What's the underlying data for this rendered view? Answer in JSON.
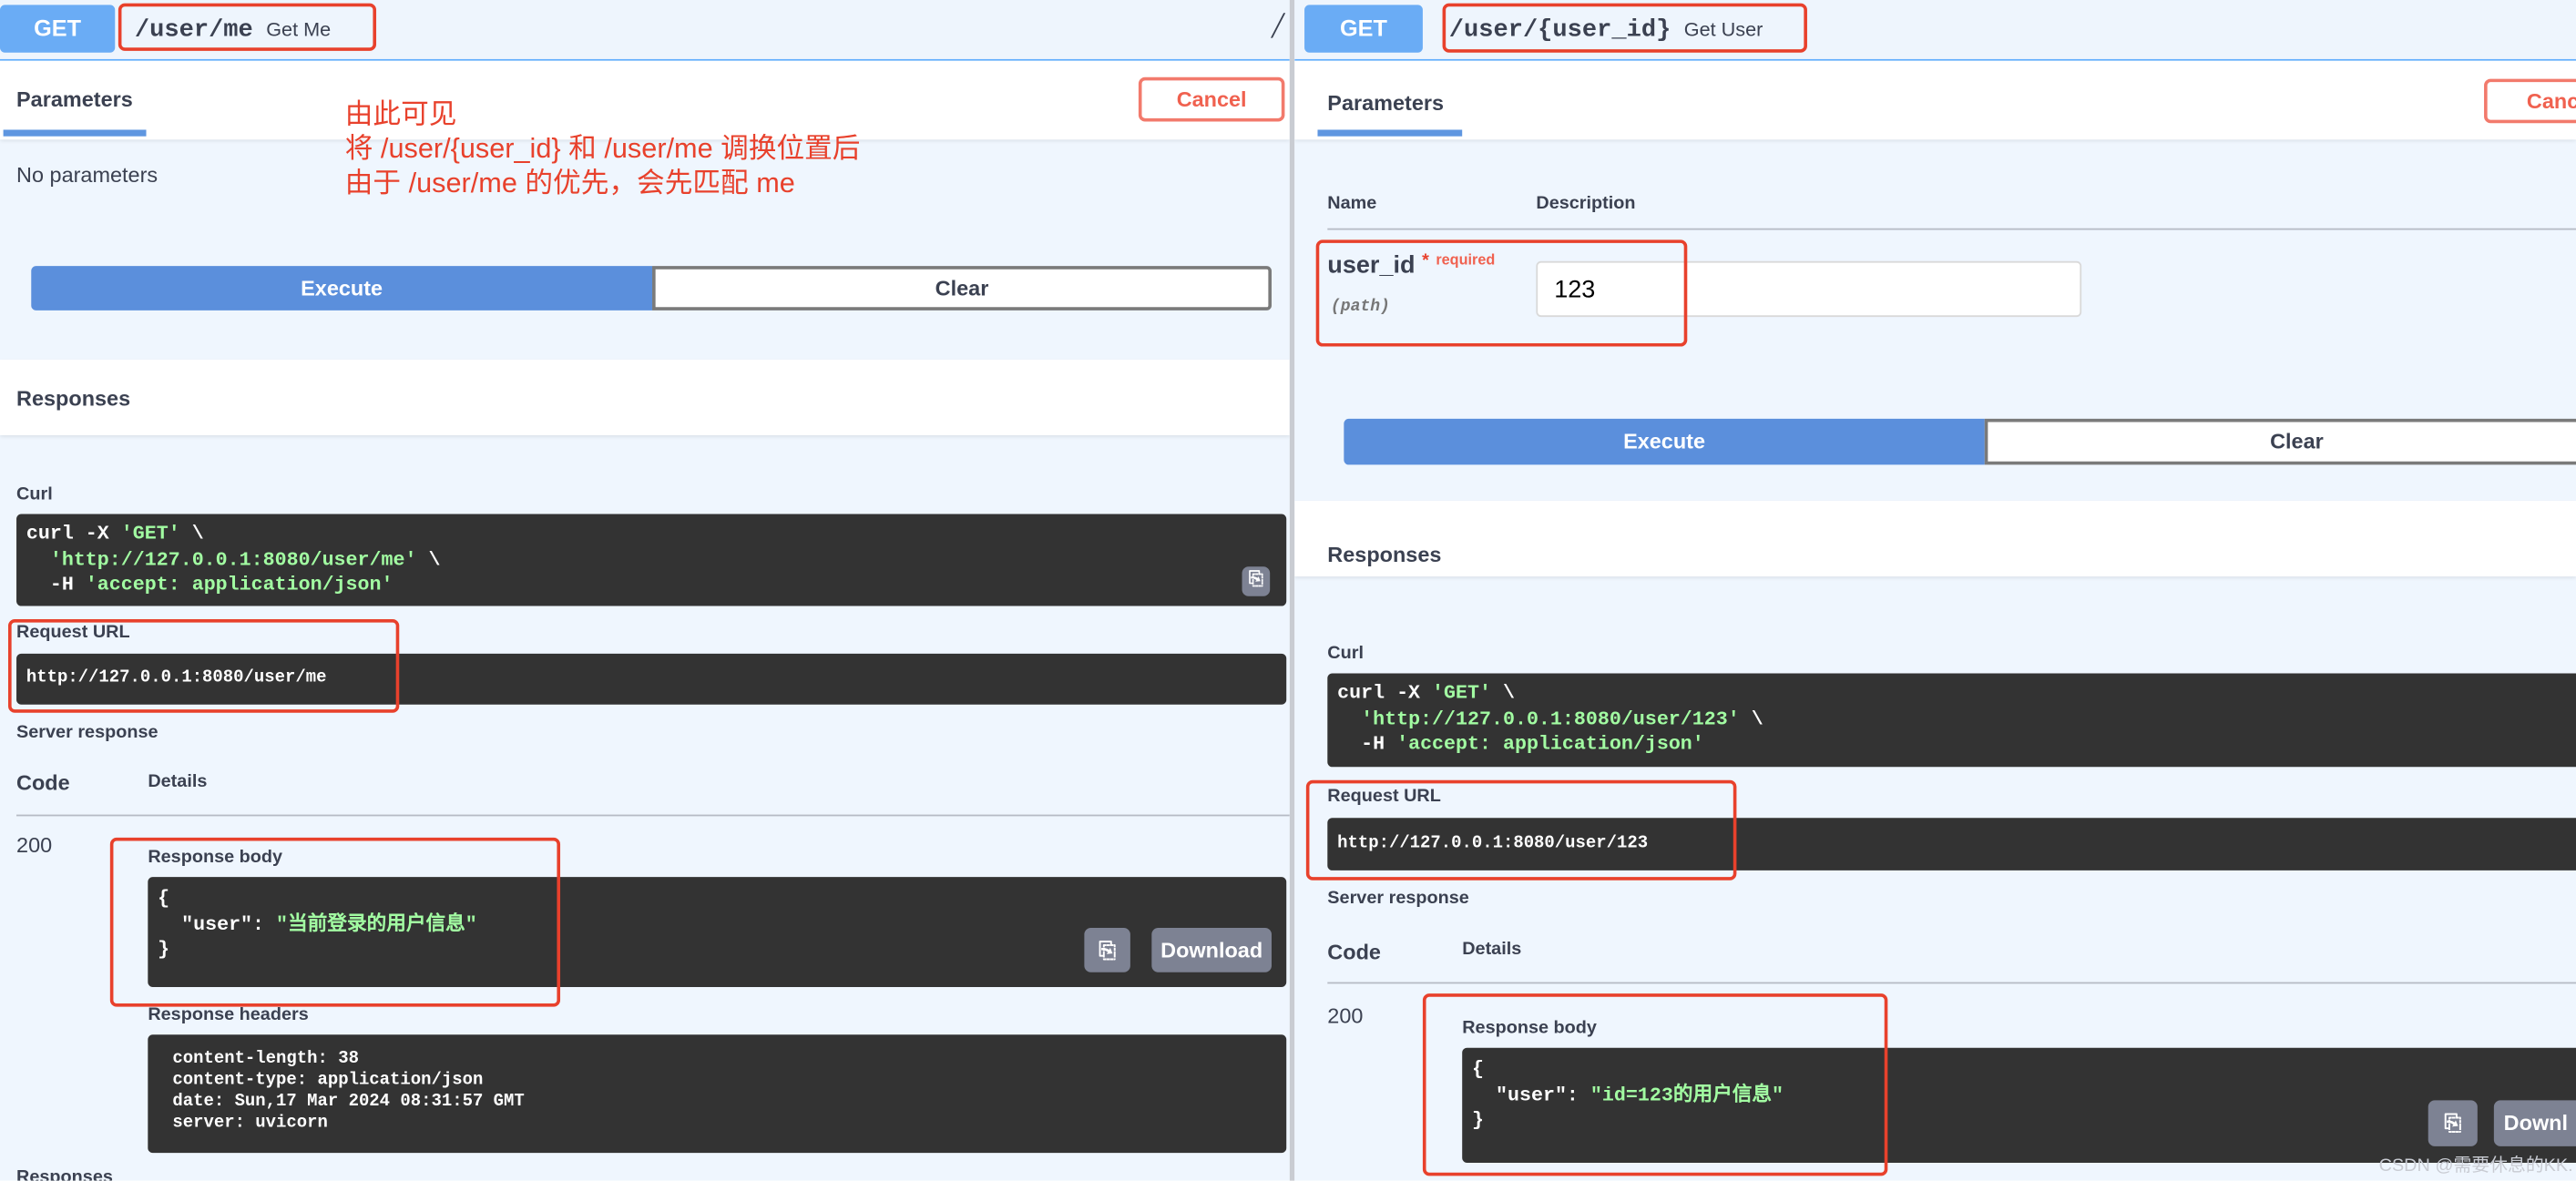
{
  "left": {
    "method": "GET",
    "path": "/user/me",
    "summary": "Get Me",
    "parameters_tab": "Parameters",
    "cancel_label": "Cancel",
    "annotation": [
      "由此可见",
      "将 /user/{user_id} 和 /user/me 调换位置后",
      "由于 /user/me 的优先，会先匹配 me"
    ],
    "no_parameters": "No parameters",
    "execute_label": "Execute",
    "clear_label": "Clear",
    "responses_title": "Responses",
    "curl_label": "Curl",
    "curl": {
      "l1a": "curl -X ",
      "l1b": "'GET'",
      "l1c": " \\",
      "l2a": "  ",
      "l2b": "'http://127.0.0.1:8080/user/me'",
      "l2c": " \\",
      "l3a": "  -H ",
      "l3b": "'accept: application/json'"
    },
    "request_url_label": "Request URL",
    "request_url": "http://127.0.0.1:8080/user/me",
    "server_response_label": "Server response",
    "code_header": "Code",
    "details_header": "Details",
    "status_code": "200",
    "response_body_label": "Response body",
    "body": {
      "open": "{",
      "key": "  \"user\": ",
      "value": "\"当前登录的用户信息\"",
      "close": "}"
    },
    "download_label": "Download",
    "response_headers_label": "Response headers",
    "headers": [
      "content-length: 38",
      "content-type: application/json",
      "date: Sun,17 Mar 2024 08:31:57 GMT",
      "server: uvicorn"
    ],
    "responses_footer": "Responses"
  },
  "right": {
    "method": "GET",
    "path": "/user/{user_id}",
    "summary": "Get User",
    "parameters_tab": "Parameters",
    "cancel_label": "Canc",
    "name_header": "Name",
    "description_header": "Description",
    "param_name": "user_id",
    "required_star": "*",
    "required_label": "required",
    "param_in": "(path)",
    "param_value": "123",
    "execute_label": "Execute",
    "clear_label": "Clear",
    "responses_title": "Responses",
    "curl_label": "Curl",
    "curl": {
      "l1a": "curl -X ",
      "l1b": "'GET'",
      "l1c": " \\",
      "l2a": "  ",
      "l2b": "'http://127.0.0.1:8080/user/123'",
      "l2c": " \\",
      "l3a": "  -H ",
      "l3b": "'accept: application/json'"
    },
    "request_url_label": "Request URL",
    "request_url": "http://127.0.0.1:8080/user/123",
    "server_response_label": "Server response",
    "code_header": "Code",
    "details_header": "Details",
    "status_code": "200",
    "response_body_label": "Response body",
    "body": {
      "open": "{",
      "key": "  \"user\": ",
      "value": "\"id=123的用户信息\"",
      "close": "}"
    },
    "download_label": "Downl"
  },
  "watermark": "CSDN @需要休息的KK.",
  "colors": {
    "method_get": "#6aacf5",
    "execute": "#5b8fdc",
    "annotation": "#e8412c",
    "cancel": "#f0614f",
    "code_bg": "#333333",
    "code_string": "#a2fca2"
  }
}
